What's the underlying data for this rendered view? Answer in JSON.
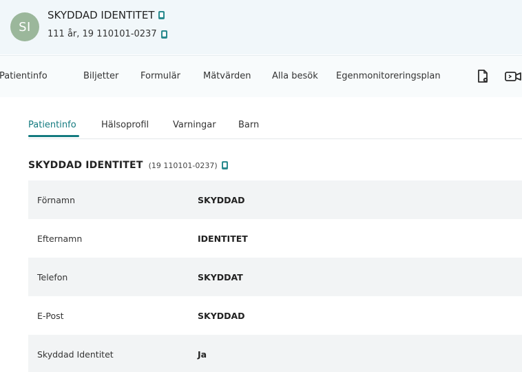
{
  "patient": {
    "initials": "SI",
    "name": "SKYDDAD IDENTITET",
    "age_id": "111 år, 19 110101-0237"
  },
  "main_nav": {
    "items": [
      "Patientinfo",
      "Biljetter",
      "Formulär",
      "Mätvärden",
      "Alla besök",
      "Egenmonitoreringsplan"
    ],
    "icons": [
      "document-icon",
      "video-call-icon"
    ]
  },
  "sub_tabs": {
    "items": [
      "Patientinfo",
      "Hälsoprofil",
      "Varningar",
      "Barn"
    ],
    "active": "Patientinfo"
  },
  "section": {
    "name": "SKYDDAD IDENTITET",
    "id": "(19 110101-0237)"
  },
  "rows": [
    {
      "label": "Förnamn",
      "value": "SKYDDAD"
    },
    {
      "label": "Efternamn",
      "value": "IDENTITET"
    },
    {
      "label": "Telefon",
      "value": "SKYDDAT"
    },
    {
      "label": "E-Post",
      "value": "SKYDDAD"
    },
    {
      "label": "Skyddad Identitet",
      "value": "Ja"
    }
  ],
  "colors": {
    "accent": "#137a7f",
    "copy_icon": "#2a8a8e",
    "avatar": "#9bb79b",
    "header_bg": "#f1f7fa"
  }
}
